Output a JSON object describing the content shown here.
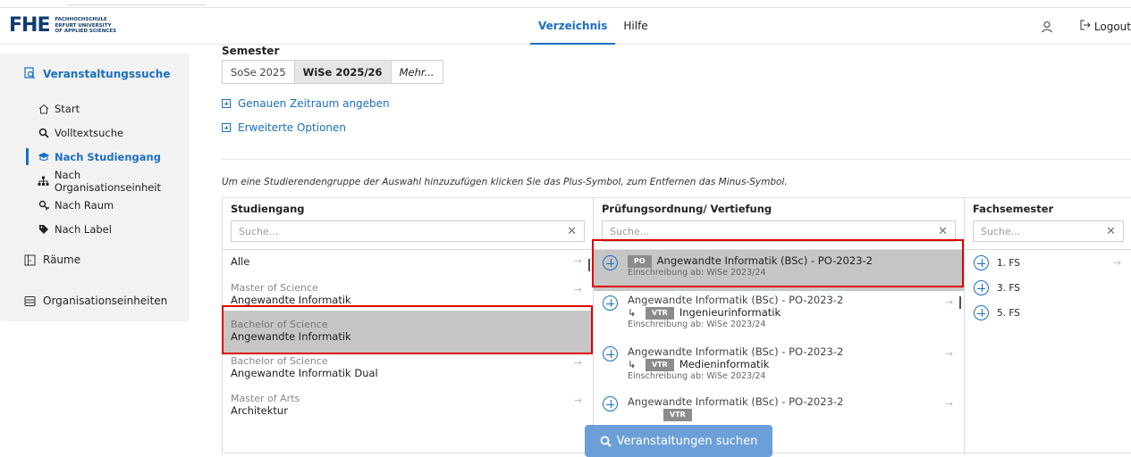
{
  "header": {
    "logo_mark": "FHE",
    "logo_lines": [
      "FACHHOCHSCHULE",
      "ERFURT UNIVERSITY",
      "OF APPLIED SCIENCES"
    ],
    "nav": [
      {
        "label": "Verzeichnis",
        "active": true
      },
      {
        "label": "Hilfe",
        "active": false
      }
    ],
    "logout_label": "Logout"
  },
  "sidebar": {
    "main_label": "Veranstaltungssuche",
    "items": [
      {
        "label": "Start",
        "icon": "home-icon"
      },
      {
        "label": "Volltextsuche",
        "icon": "search-icon"
      },
      {
        "label": "Nach Studiengang",
        "icon": "graduation-cap-icon",
        "active": true
      },
      {
        "label": "Nach Organisationseinheit",
        "icon": "sitemap-icon"
      },
      {
        "label": "Nach Raum",
        "icon": "room-search-icon"
      },
      {
        "label": "Nach Label",
        "icon": "tag-icon"
      }
    ],
    "rooms_label": "Räume",
    "org_label": "Organisationseinheiten"
  },
  "filters": {
    "semester_label": "Semester",
    "semesters": [
      "SoSe 2025",
      "WiSe 2025/26",
      "Mehr..."
    ],
    "selected_semester": "WiSe 2025/26",
    "timespan_link": "Genauen Zeitraum angeben",
    "options_link": "Erweiterte Optionen"
  },
  "hint": "Um eine Studierendengruppe der Auswahl hinzuzufügen klicken Sie das Plus-Symbol, zum Entfernen das Minus-Symbol.",
  "columns": {
    "studiengang": {
      "header": "Studiengang",
      "placeholder": "Suche...",
      "rows": [
        {
          "sub": "",
          "main": "Alle"
        },
        {
          "sub": "Master of Science",
          "main": "Angewandte Informatik"
        },
        {
          "sub": "Bachelor of Science",
          "main": "Angewandte Informatik",
          "selected": true
        },
        {
          "sub": "Bachelor of Science",
          "main": "Angewandte Informatik Dual"
        },
        {
          "sub": "Master of Arts",
          "main": "Architektur"
        }
      ]
    },
    "pruefungsordnung": {
      "header": "Prüfungsordnung/ Vertiefung",
      "placeholder": "Suche...",
      "rows": [
        {
          "badge": "PO",
          "title": "Angewandte Informatik (BSc) - PO-2023-2",
          "note": "Einschreibung ab: WiSe 2023/24",
          "selected": true
        },
        {
          "title": "Angewandte Informatik (BSc) - PO-2023-2",
          "badge": "VTR",
          "vertiefung": "Ingenieurinformatik",
          "note": "Einschreibung ab: WiSe 2023/24"
        },
        {
          "title": "Angewandte Informatik (BSc) - PO-2023-2",
          "badge": "VTR",
          "vertiefung": "Medieninformatik",
          "note": "Einschreibung ab: WiSe 2023/24"
        },
        {
          "title": "Angewandte Informatik (BSc) - PO-2023-2",
          "badge": "VTR",
          "vertiefung": "",
          "note": ""
        }
      ]
    },
    "fachsemester": {
      "header": "Fachsemester",
      "placeholder": "Suche...",
      "rows": [
        "1. FS",
        "3. FS",
        "5. FS"
      ]
    }
  },
  "search_button": "Veranstaltungen suchen",
  "colors": {
    "accent": "#1a6fc0",
    "selection": "#c6c6c6",
    "highlight": "#e00000",
    "button": "#6c9fd8"
  }
}
